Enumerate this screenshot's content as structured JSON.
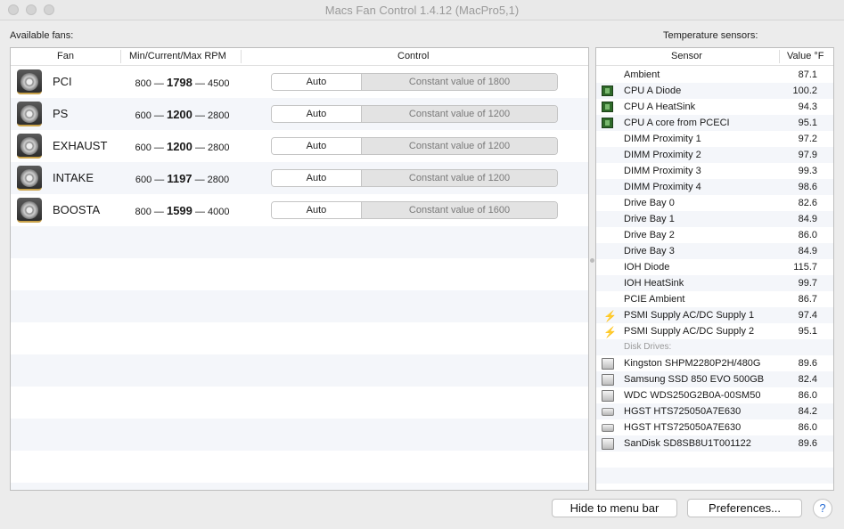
{
  "window": {
    "title": "Macs Fan Control 1.4.12 (MacPro5,1)"
  },
  "fans_section": {
    "label": "Available fans:",
    "columns": {
      "fan": "Fan",
      "rpm": "Min/Current/Max RPM",
      "control": "Control"
    },
    "fans": [
      {
        "name": "PCI",
        "min": "800",
        "current": "1798",
        "max": "4500",
        "auto_label": "Auto",
        "constant_label": "Constant value of 1800"
      },
      {
        "name": "PS",
        "min": "600",
        "current": "1200",
        "max": "2800",
        "auto_label": "Auto",
        "constant_label": "Constant value of 1200"
      },
      {
        "name": "EXHAUST",
        "min": "600",
        "current": "1200",
        "max": "2800",
        "auto_label": "Auto",
        "constant_label": "Constant value of 1200"
      },
      {
        "name": "INTAKE",
        "min": "600",
        "current": "1197",
        "max": "2800",
        "auto_label": "Auto",
        "constant_label": "Constant value of 1200"
      },
      {
        "name": "BOOSTA",
        "min": "800",
        "current": "1599",
        "max": "4000",
        "auto_label": "Auto",
        "constant_label": "Constant value of 1600"
      }
    ],
    "dash": "—"
  },
  "sensors_section": {
    "label": "Temperature sensors:",
    "columns": {
      "sensor": "Sensor",
      "value": "Value °F"
    },
    "sensors": [
      {
        "icon": "none",
        "name": "Ambient",
        "value": "87.1"
      },
      {
        "icon": "cpu-chip",
        "name": "CPU A Diode",
        "value": "100.2"
      },
      {
        "icon": "cpu-chip",
        "name": "CPU A HeatSink",
        "value": "94.3"
      },
      {
        "icon": "cpu-chip",
        "name": "CPU A core from PCECI",
        "value": "95.1"
      },
      {
        "icon": "none",
        "name": "DIMM Proximity 1",
        "value": "97.2"
      },
      {
        "icon": "none",
        "name": "DIMM Proximity 2",
        "value": "97.9"
      },
      {
        "icon": "none",
        "name": "DIMM Proximity 3",
        "value": "99.3"
      },
      {
        "icon": "none",
        "name": "DIMM Proximity 4",
        "value": "98.6"
      },
      {
        "icon": "none",
        "name": "Drive Bay 0",
        "value": "82.6"
      },
      {
        "icon": "none",
        "name": "Drive Bay 1",
        "value": "84.9"
      },
      {
        "icon": "none",
        "name": "Drive Bay 2",
        "value": "86.0"
      },
      {
        "icon": "none",
        "name": "Drive Bay 3",
        "value": "84.9"
      },
      {
        "icon": "none",
        "name": "IOH Diode",
        "value": "115.7"
      },
      {
        "icon": "none",
        "name": "IOH HeatSink",
        "value": "99.7"
      },
      {
        "icon": "none",
        "name": "PCIE Ambient",
        "value": "86.7"
      },
      {
        "icon": "bolt",
        "name": "PSMI Supply AC/DC Supply 1",
        "value": "97.4"
      },
      {
        "icon": "bolt",
        "name": "PSMI Supply AC/DC Supply 2",
        "value": "95.1"
      }
    ],
    "disk_group_label": "Disk Drives:",
    "disks": [
      {
        "icon": "ssd",
        "name": "Kingston SHPM2280P2H/480G",
        "value": "89.6"
      },
      {
        "icon": "ssd",
        "name": "Samsung SSD 850 EVO 500GB",
        "value": "82.4"
      },
      {
        "icon": "ssd",
        "name": "WDC WDS250G2B0A-00SM50",
        "value": "86.0"
      },
      {
        "icon": "hdd",
        "name": "HGST HTS725050A7E630",
        "value": "84.2"
      },
      {
        "icon": "hdd",
        "name": "HGST HTS725050A7E630",
        "value": "86.0"
      },
      {
        "icon": "ssd",
        "name": "SanDisk SD8SB8U1T001122",
        "value": "89.6"
      }
    ]
  },
  "footer": {
    "hide_button": "Hide to menu bar",
    "preferences_button": "Preferences...",
    "help_button": "?"
  }
}
